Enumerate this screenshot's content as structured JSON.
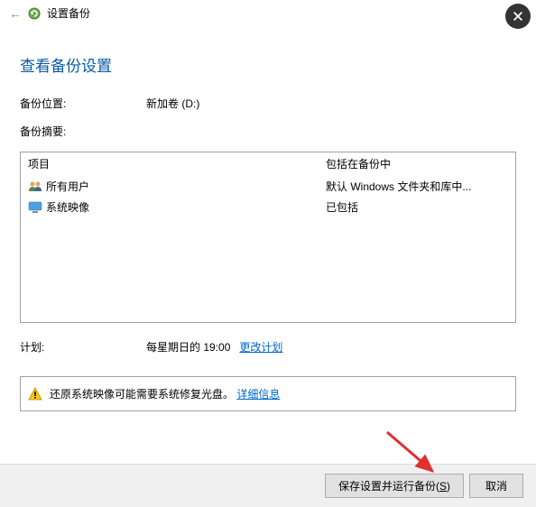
{
  "window": {
    "title": "设置备份"
  },
  "heading": "查看备份设置",
  "fields": {
    "location_label": "备份位置:",
    "location_value": "新加卷 (D:)",
    "summary_label": "备份摘要:"
  },
  "table": {
    "headers": {
      "item": "项目",
      "included": "包括在备份中"
    },
    "rows": [
      {
        "item": "所有用户",
        "included": "默认 Windows 文件夹和库中..."
      },
      {
        "item": "系统映像",
        "included": "已包括"
      }
    ]
  },
  "schedule": {
    "label": "计划:",
    "value": "每星期日的 19:00",
    "change_link": "更改计划"
  },
  "warning": {
    "text": "还原系统映像可能需要系统修复光盘。",
    "link": "详细信息"
  },
  "buttons": {
    "save_prefix": "保存设置并运行备份(",
    "save_hotkey": "S",
    "save_suffix": ")",
    "cancel": "取消"
  }
}
